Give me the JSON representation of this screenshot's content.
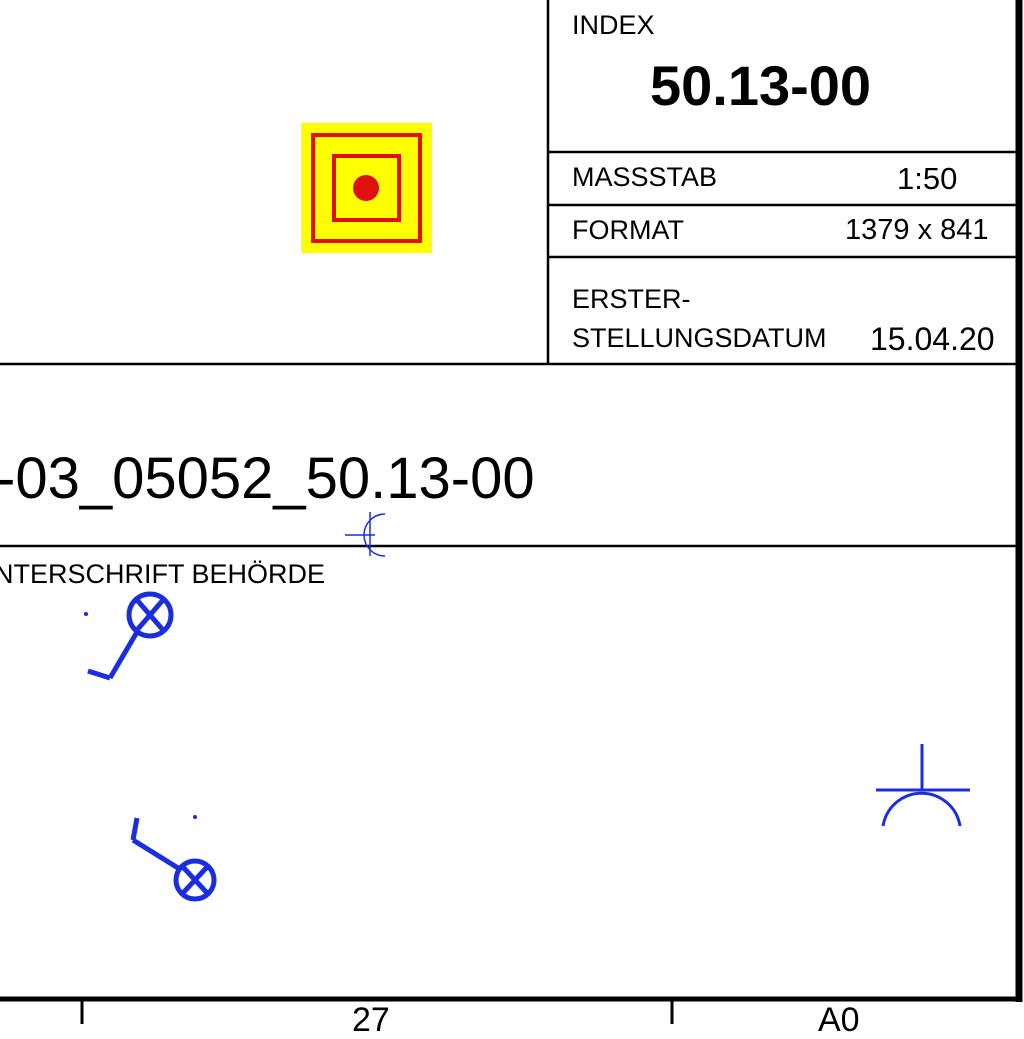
{
  "title_block": {
    "index_label": "INDEX",
    "index_value": "50.13-00",
    "scale_label": "MASSSTAB",
    "scale_value": "1:50",
    "format_label": "FORMAT",
    "format_value": "1379 x 841",
    "date_label_line1": "ERSTER-",
    "date_label_line2": "STELLUNGSDATUM",
    "date_value": "15.04.20",
    "drawing_number": "-03_05052_50.13-00",
    "signature_label": "NTERSCHRIFT BEHÖRDE",
    "bottom_left_cell": "27",
    "bottom_right_cell": "A0"
  },
  "colors": {
    "line": "#000000",
    "symbol_blue": "#1a2ee0",
    "marker_yellow": "#ffff00",
    "marker_red": "#e01010"
  },
  "icons": {
    "marker": "target-square-icon",
    "symbols": [
      "lamp-cross-icon",
      "socket-outlet-icon"
    ]
  }
}
